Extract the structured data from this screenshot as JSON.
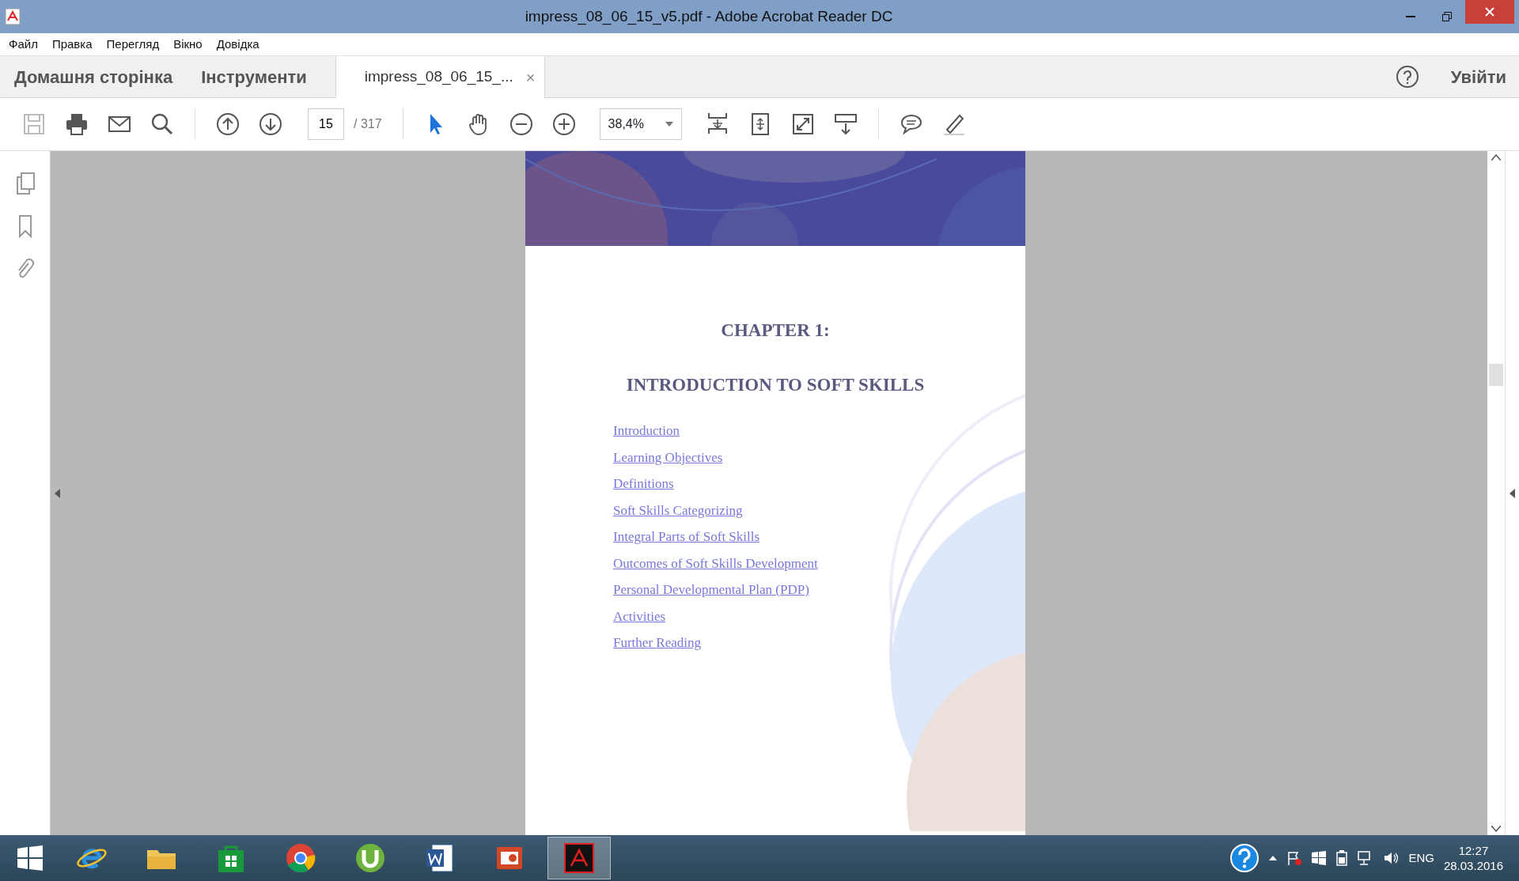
{
  "window": {
    "title": "impress_08_06_15_v5.pdf - Adobe Acrobat Reader DC"
  },
  "menu": [
    "Файл",
    "Правка",
    "Перегляд",
    "Вікно",
    "Довідка"
  ],
  "tabs": [
    {
      "label": "Домашня сторінка",
      "selected": false
    },
    {
      "label": "Інструменти",
      "selected": false
    },
    {
      "label": "impress_08_06_15_...",
      "selected": true,
      "close": "×"
    }
  ],
  "sign_in": "Увійти",
  "toolbar": {
    "save": {
      "disabled": true
    },
    "select_tool": {
      "selected": true
    },
    "hand_tool": {
      "selected": false
    },
    "page": "15",
    "page_count": "/ 317",
    "zoom": "38,4%"
  },
  "document": {
    "chapter": "CHAPTER 1:",
    "title": "INTRODUCTION TO SOFT SKILLS",
    "links": [
      "Introduction",
      "Learning Objectives",
      "Definitions",
      "Soft Skills Categorizing",
      "Integral Parts of Soft Skills",
      "Outcomes of Soft Skills Development",
      "Personal Developmental Plan (PDP)",
      "Activities",
      "Further Reading"
    ]
  },
  "taskbar": {
    "apps": [
      {
        "selected": false
      },
      {
        "selected": false
      },
      {
        "selected": false
      },
      {
        "selected": false
      },
      {
        "selected": false
      },
      {
        "selected": false
      },
      {
        "selected": false
      },
      {
        "selected": true
      }
    ],
    "language": "ENG",
    "time": "12:27",
    "date": "28.03.2016"
  }
}
